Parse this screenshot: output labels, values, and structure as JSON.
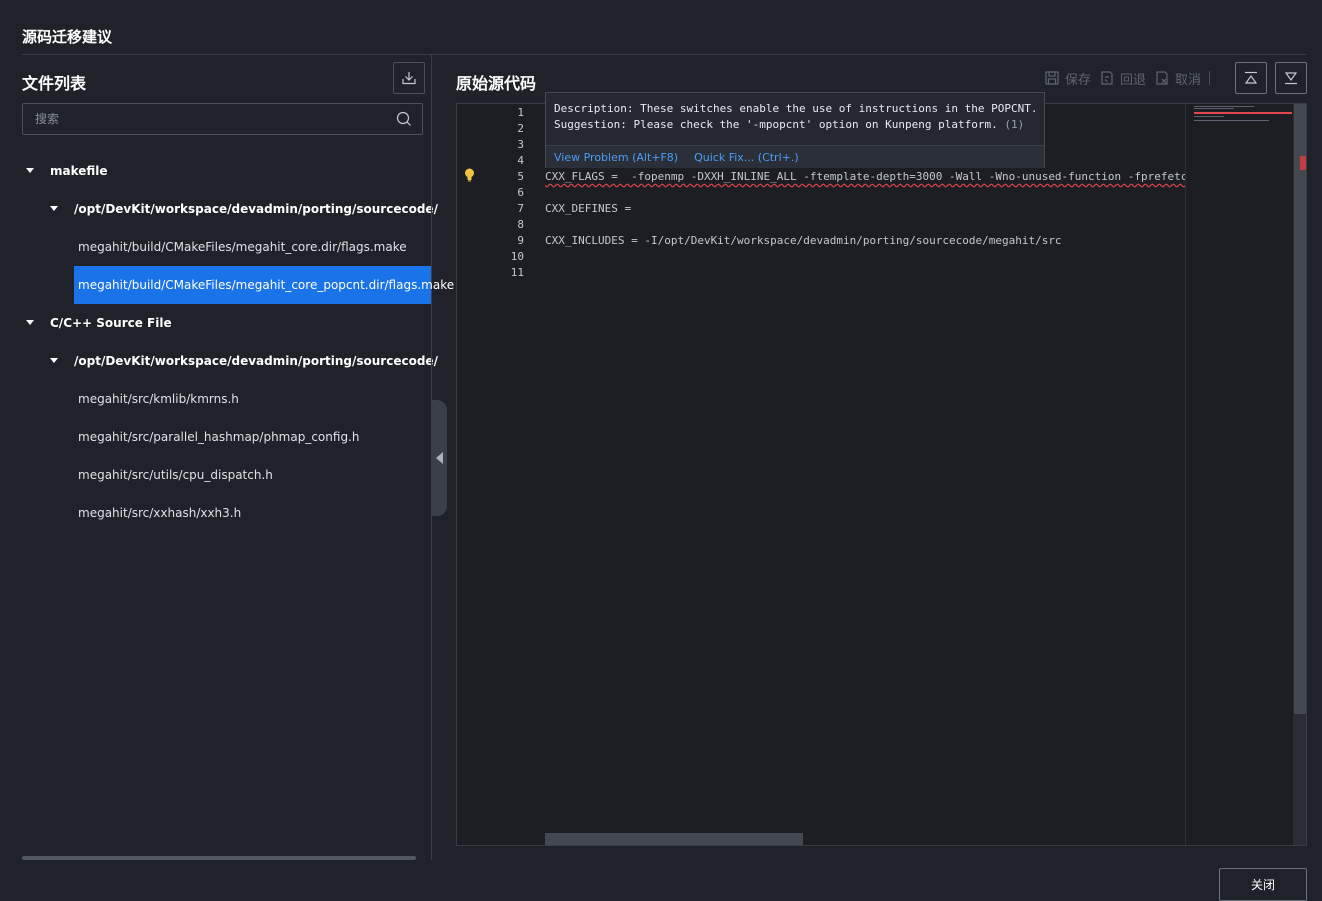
{
  "dialog": {
    "title": "源码迁移建议",
    "close_label": "关闭"
  },
  "file_list": {
    "title": "文件列表",
    "download_icon": "download-icon",
    "search_placeholder": "搜索",
    "groups": [
      {
        "label": "makefile",
        "folders": [
          {
            "label": "/opt/DevKit/workspace/devadmin/porting/sourcecode/",
            "files": [
              {
                "label": "megahit/build/CMakeFiles/megahit_core.dir/flags.make"
              },
              {
                "label": "megahit/build/CMakeFiles/megahit_core_popcnt.dir/flags.make",
                "selected": true
              }
            ]
          }
        ]
      },
      {
        "label": "C/C++ Source File",
        "folders": [
          {
            "label": "/opt/DevKit/workspace/devadmin/porting/sourcecode/",
            "files": [
              {
                "label": "megahit/src/kmlib/kmrns.h"
              },
              {
                "label": "megahit/src/parallel_hashmap/phmap_config.h"
              },
              {
                "label": "megahit/src/utils/cpu_dispatch.h"
              },
              {
                "label": "megahit/src/xxhash/xxh3.h"
              }
            ]
          }
        ]
      }
    ]
  },
  "source_panel": {
    "title": "原始源代码",
    "toolbar": {
      "save_label": "保存",
      "revert_label": "回退",
      "cancel_label": "取消"
    }
  },
  "editor": {
    "line_numbers": [
      "1",
      "2",
      "3",
      "4",
      "5",
      "6",
      "7",
      "8",
      "9",
      "10",
      "11"
    ],
    "lines": [
      "",
      "",
      "",
      "",
      "CXX_FLAGS =  -fopenmp -DXXH_INLINE_ALL -ftemplate-depth=3000 -Wall -Wno-unused-function -fprefetc",
      "",
      "CXX_DEFINES = ",
      "",
      "CXX_INCLUDES = -I/opt/DevKit/workspace/devadmin/porting/sourcecode/megahit/src",
      "",
      ""
    ],
    "hover": {
      "description": "Description: These switches enable the use of instructions in the POPCNT.",
      "suggestion": "Suggestion: Please check the '-mpopcnt' option on Kunpeng platform.",
      "count": "(1)",
      "view_problem": "View Problem (Alt+F8)",
      "quick_fix": "Quick Fix... (Ctrl+.)"
    }
  },
  "colors": {
    "accent": "#1a73e8",
    "error": "#e0484e",
    "link": "#4a9cf8",
    "background": "#1f2229"
  }
}
